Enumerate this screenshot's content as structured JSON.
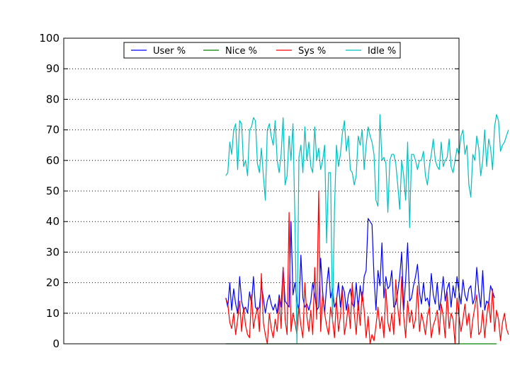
{
  "chart_data": {
    "type": "line",
    "title": "",
    "xlabel": "",
    "ylabel": "",
    "ylim": [
      0,
      100
    ],
    "yticks": [
      0,
      10,
      20,
      30,
      40,
      50,
      60,
      70,
      80,
      90,
      100
    ],
    "xlim": [
      0,
      200
    ],
    "grid": "horizontal-dotted",
    "legend_position": "top-center",
    "x": [
      0,
      1,
      2,
      3,
      4,
      5,
      6,
      7,
      8,
      9,
      10,
      11,
      12,
      13,
      14,
      15,
      16,
      17,
      18,
      19,
      20,
      21,
      22,
      23,
      24,
      25,
      26,
      27,
      28,
      29,
      30,
      31,
      32,
      33,
      34,
      35,
      36,
      37,
      38,
      39,
      40,
      41,
      42,
      43,
      44,
      45,
      46,
      47,
      48,
      49,
      50,
      51,
      52,
      53,
      54,
      55,
      56,
      57,
      58,
      59,
      60,
      61,
      62,
      63,
      64,
      65,
      66,
      67,
      68,
      69,
      70,
      71,
      72,
      73,
      74,
      75,
      76,
      77,
      78,
      79,
      80,
      81,
      82,
      83,
      84,
      85,
      86,
      87,
      88,
      89,
      90,
      91,
      92,
      93,
      94,
      95,
      96,
      97,
      98,
      99,
      100,
      101,
      102,
      103,
      104,
      105,
      106,
      107,
      108,
      109,
      110,
      111,
      112,
      113,
      114,
      115,
      116,
      117,
      118,
      119,
      120,
      121,
      122,
      123,
      124,
      125,
      126,
      127,
      128,
      129,
      130,
      131,
      132,
      133,
      134,
      135,
      136,
      137,
      138,
      139,
      140,
      141,
      142,
      143,
      144,
      145,
      146,
      147,
      148,
      149,
      150,
      151,
      152,
      153,
      154,
      155,
      156,
      157,
      158,
      159,
      160,
      161,
      162,
      163,
      164,
      165,
      166,
      167,
      168,
      169,
      170,
      171,
      172,
      173,
      174,
      175,
      176,
      177,
      178,
      179,
      180,
      181,
      182,
      183,
      184,
      185,
      186,
      187,
      188,
      189,
      190,
      191,
      192,
      193,
      194,
      195,
      196,
      197,
      198,
      199,
      200
    ],
    "series": [
      {
        "name": "User %",
        "color": "#0000ff",
        "x_start": 82,
        "values": [
          15,
          12,
          20,
          11,
          18,
          13,
          10,
          22,
          14,
          11,
          12,
          10,
          17,
          13,
          22,
          12,
          11,
          12,
          19,
          15,
          10,
          14,
          16,
          13,
          11,
          13,
          10,
          16,
          12,
          25,
          14,
          13,
          12,
          40,
          16,
          20,
          14,
          11,
          29,
          15,
          12,
          13,
          11,
          14,
          20,
          16,
          11,
          12,
          28,
          17,
          10,
          19,
          25,
          15,
          18,
          12,
          14,
          20,
          12,
          19,
          17,
          11,
          16,
          18,
          13,
          12,
          20,
          11,
          19,
          14,
          22,
          24,
          41,
          40,
          39,
          22,
          11,
          24,
          19,
          33,
          15,
          22,
          18,
          19,
          24,
          12,
          13,
          17,
          22,
          30,
          11,
          21,
          33,
          14,
          15,
          19,
          22,
          26,
          17,
          13,
          20,
          14,
          15,
          12,
          23,
          16,
          13,
          20,
          11,
          15,
          22,
          14,
          18,
          20,
          12,
          19,
          15,
          22,
          17,
          13,
          21,
          16,
          14,
          18,
          19,
          13,
          15,
          25,
          17,
          12,
          24,
          11,
          14,
          13,
          19,
          17,
          15
        ]
      },
      {
        "name": "Nice %",
        "color": "#008000",
        "x_start": 82,
        "values": [
          0,
          0,
          0,
          0,
          0,
          0,
          0,
          0,
          0,
          0,
          0,
          0,
          0,
          0,
          0,
          0,
          0,
          0,
          0,
          0,
          0,
          0,
          0,
          0,
          0,
          0,
          0,
          0,
          0,
          0,
          0,
          0,
          0,
          0,
          0,
          0,
          0,
          0,
          0,
          0,
          0,
          0,
          0,
          0,
          0,
          0,
          0,
          0,
          0,
          0,
          0,
          0,
          0,
          0,
          0,
          0,
          0,
          0,
          0,
          0,
          0,
          0,
          0,
          0,
          0,
          0,
          0,
          0,
          0,
          0,
          0,
          0,
          0,
          0,
          0,
          0,
          0,
          0,
          0,
          0,
          0,
          0,
          0,
          0,
          0,
          0,
          0,
          0,
          0,
          0,
          0,
          0,
          0,
          0,
          0,
          0,
          0,
          0,
          0,
          0,
          0,
          0,
          0,
          0,
          0,
          0,
          0,
          0,
          0,
          0,
          0,
          0,
          0,
          0,
          0,
          0,
          0,
          0,
          0,
          0,
          0,
          0,
          0,
          0,
          0,
          0,
          0,
          0,
          0,
          0,
          0,
          0,
          0,
          0,
          0,
          0,
          0,
          0
        ]
      },
      {
        "name": "Sys %",
        "color": "#ff0000",
        "x_start": 82,
        "values": [
          15,
          13,
          7,
          5,
          10,
          3,
          8,
          14,
          4,
          12,
          6,
          3,
          2,
          16,
          5,
          9,
          12,
          4,
          23,
          7,
          3,
          0,
          10,
          5,
          2,
          8,
          4,
          15,
          5,
          25,
          8,
          3,
          43,
          4,
          10,
          7,
          3,
          12,
          6,
          2,
          20,
          9,
          4,
          11,
          3,
          25,
          8,
          50,
          4,
          16,
          10,
          6,
          3,
          12,
          8,
          2,
          15,
          4,
          9,
          18,
          3,
          7,
          13,
          5,
          20,
          10,
          3,
          14,
          6,
          17,
          11,
          2,
          9,
          0,
          3,
          1,
          6,
          12,
          5,
          9,
          2,
          18,
          7,
          4,
          10,
          3,
          21,
          12,
          6,
          22,
          9,
          2,
          14,
          7,
          11,
          5,
          8,
          19,
          4,
          10,
          7,
          3,
          9,
          12,
          2,
          6,
          8,
          11,
          3,
          13,
          9,
          2,
          17,
          5,
          10,
          8,
          0,
          15,
          9,
          4,
          8,
          13,
          6,
          10,
          2,
          8,
          12,
          16,
          3,
          4,
          11,
          2,
          9,
          14,
          7,
          18,
          4,
          11,
          8,
          1,
          7,
          10,
          5,
          3
        ]
      },
      {
        "name": "Idle %",
        "color": "#00bfbf",
        "x_start": 82,
        "values": [
          55,
          56,
          66,
          62,
          70,
          72,
          57,
          73,
          72,
          58,
          60,
          55,
          70,
          71,
          74,
          73,
          59,
          56,
          64,
          55,
          47,
          70,
          72,
          68,
          65,
          73,
          60,
          56,
          62,
          74,
          52,
          55,
          68,
          60,
          72,
          40,
          0,
          61,
          65,
          56,
          71,
          60,
          66,
          58,
          56,
          71,
          60,
          64,
          57,
          60,
          65,
          33,
          56,
          56,
          7,
          44,
          65,
          58,
          62,
          69,
          73,
          63,
          68,
          57,
          56,
          52,
          55,
          68,
          65,
          70,
          57,
          65,
          71,
          68,
          66,
          62,
          47,
          45,
          75,
          60,
          61,
          59,
          43,
          60,
          62,
          62,
          59,
          52,
          44,
          60,
          55,
          47,
          66,
          38,
          62,
          62,
          60,
          57,
          60,
          60,
          63,
          55,
          52,
          58,
          62,
          67,
          60,
          58,
          57,
          66,
          58,
          60,
          61,
          67,
          58,
          56,
          60,
          64,
          62,
          68,
          70,
          62,
          65,
          52,
          48,
          62,
          60,
          68,
          64,
          55,
          60,
          70,
          58,
          67,
          64,
          57,
          71,
          75,
          73,
          63,
          65,
          66,
          68,
          70
        ]
      }
    ]
  }
}
